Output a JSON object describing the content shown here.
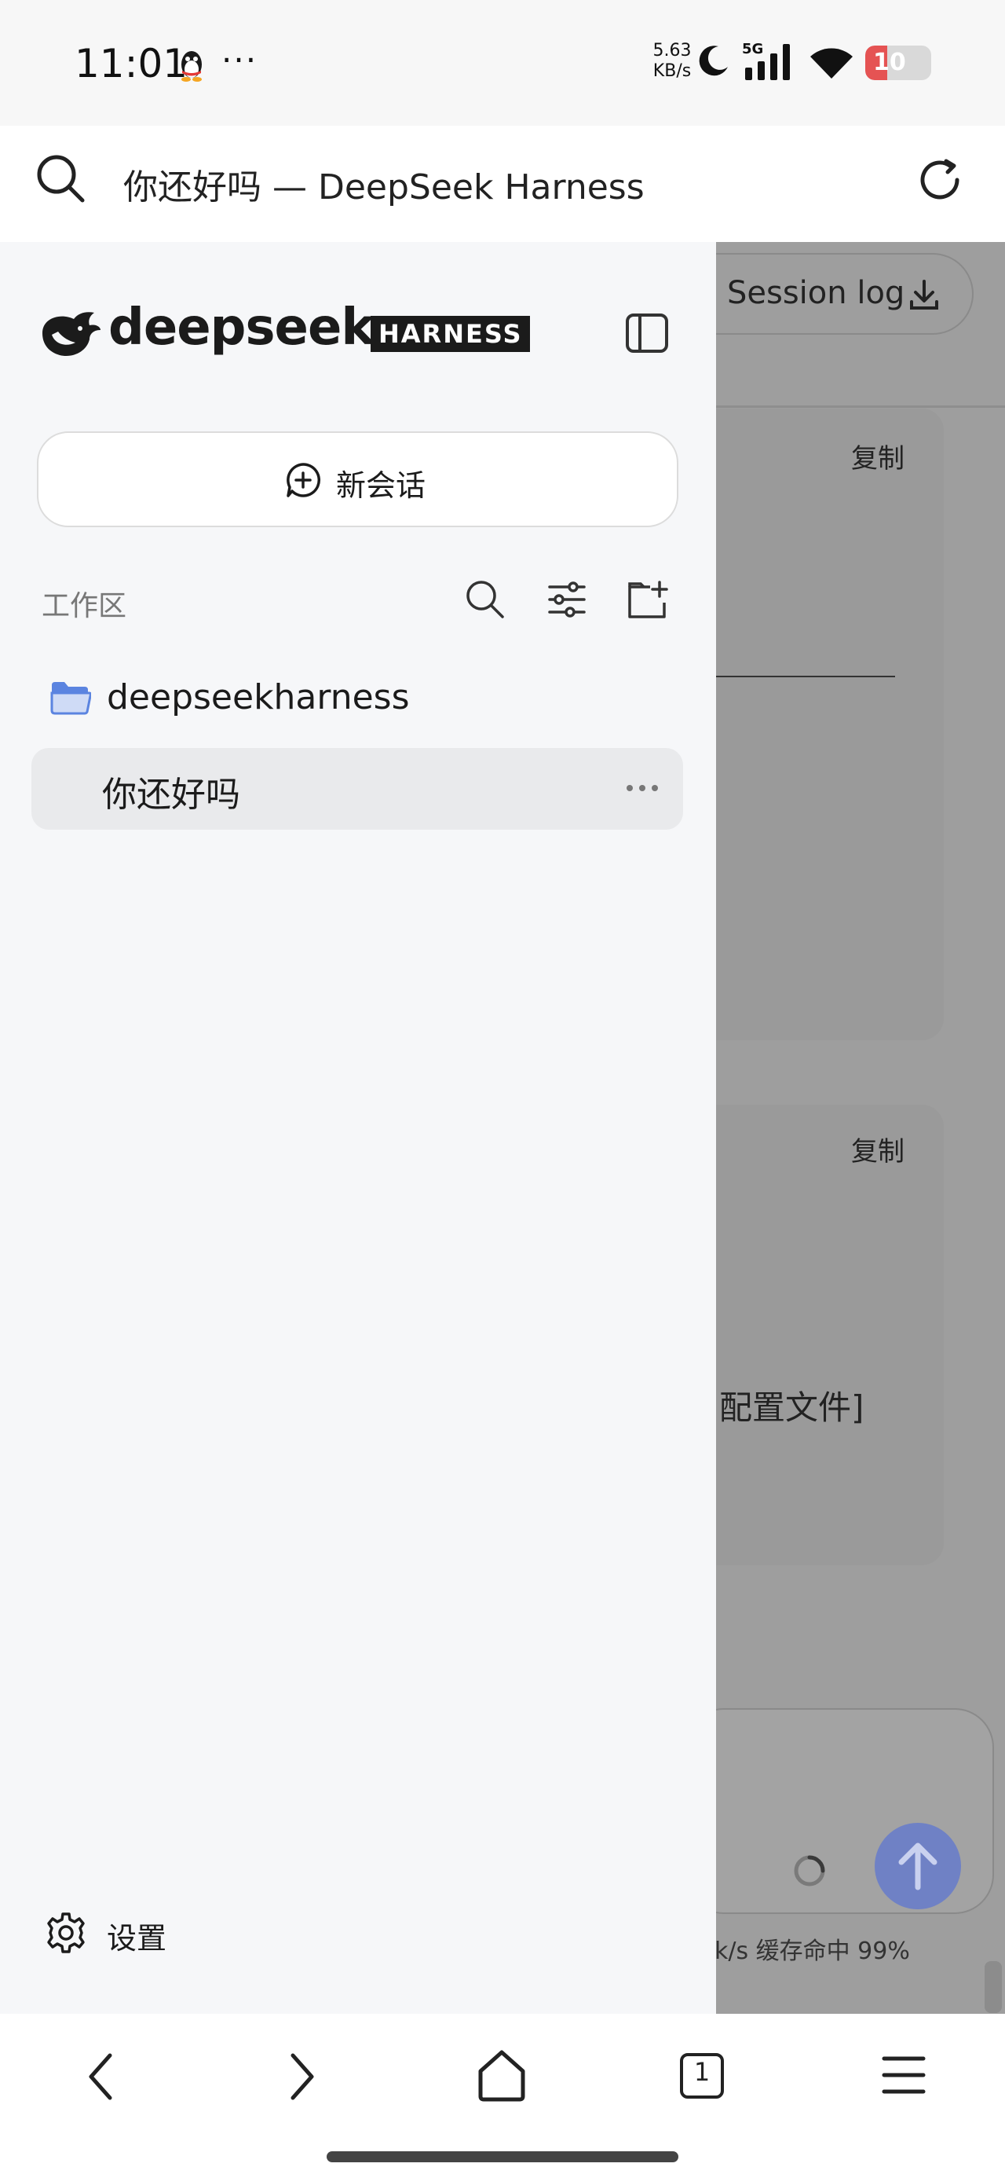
{
  "status_bar": {
    "time": "11:01",
    "net_speed_value": "5.63",
    "net_speed_unit": "KB/s",
    "network_type": "5G",
    "battery_level": "10",
    "battery_percent": 10
  },
  "browser": {
    "page_title": "你还好吗 — DeepSeek Harness",
    "tab_count": "1"
  },
  "sidebar": {
    "brand_name": "deepseek",
    "brand_badge": "HARNESS",
    "new_chat_label": "新会话",
    "workspace_label": "工作区",
    "folder_name": "deepseekharness",
    "session_title": "你还好吗",
    "settings_label": "设置"
  },
  "background": {
    "session_log_label": "Session log",
    "copy_label_1": "复制",
    "copy_label_2": "复制",
    "config_text": "配置文件]",
    "status_line": "k/s  缓存命中 99%"
  },
  "colors": {
    "sidebar_bg": "#f6f7f9",
    "overlay_bg": "#9e9e9e",
    "send_button": "#6f81c5",
    "folder_icon": "#5b84e0",
    "battery_low": "#e55353"
  }
}
